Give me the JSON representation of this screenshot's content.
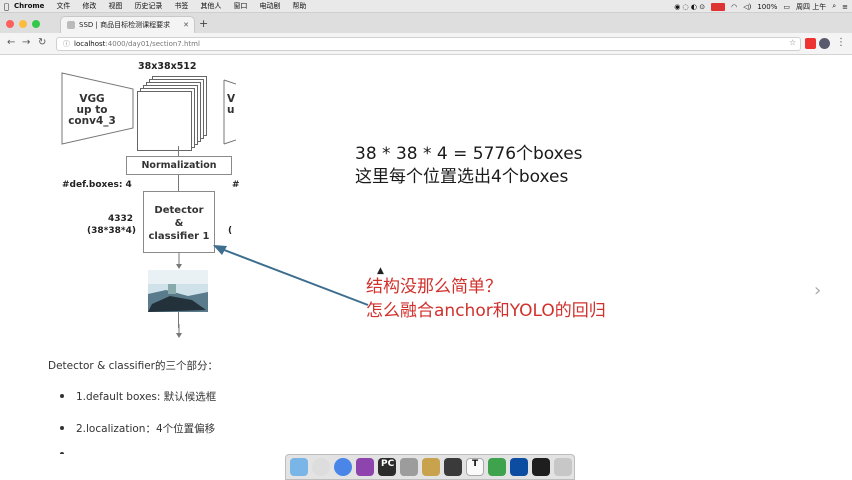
{
  "menubar": {
    "app_name": "Chrome",
    "items": [
      "文件",
      "修改",
      "视图",
      "历史记录",
      "书签",
      "其他人",
      "窗口",
      "电动剧",
      "帮助"
    ],
    "battery": "100%",
    "clock": "周四 上午",
    "colors": {
      "red": "#d33"
    }
  },
  "browser": {
    "tab_title": "SSD | 商品目标检测课程要求",
    "new_tab_label": "+",
    "url_host": "localhost",
    "url_path": ":4000/day01/section7.html"
  },
  "diagram": {
    "vgg_label_1": "VGG",
    "vgg_label_2": "up to",
    "vgg_label_3": "conv4_3",
    "vgg_partial_1": "V",
    "vgg_partial_2": "u",
    "feature_map_size": "38x38x512",
    "normalization_label": "Normalization",
    "def_boxes_label": "#def.boxes: 4",
    "count_label_1": "4332",
    "count_label_2": "(38*38*4)",
    "detector_label_1": "Detector",
    "detector_label_2": "&",
    "detector_label_3": "classifier 1",
    "hash_partial": "#",
    "paren_partial": "("
  },
  "annotations": {
    "line1": "38 * 38 * 4 = 5776个boxes",
    "line2": "这里每个位置选出4个boxes",
    "red_line1": "结构没那么简单？",
    "red_line2": "怎么融合anchor和YOLO的回归",
    "colors": {
      "red": "#d0312d",
      "arrow": "#3d6e8f"
    }
  },
  "article": {
    "heading": "Detector & classifier的三个部分：",
    "items": [
      "1.default boxes: 默认候选框",
      "2.localization：4个位置偏移"
    ]
  },
  "dock": {
    "app_labels": [
      "PC",
      "T"
    ]
  }
}
